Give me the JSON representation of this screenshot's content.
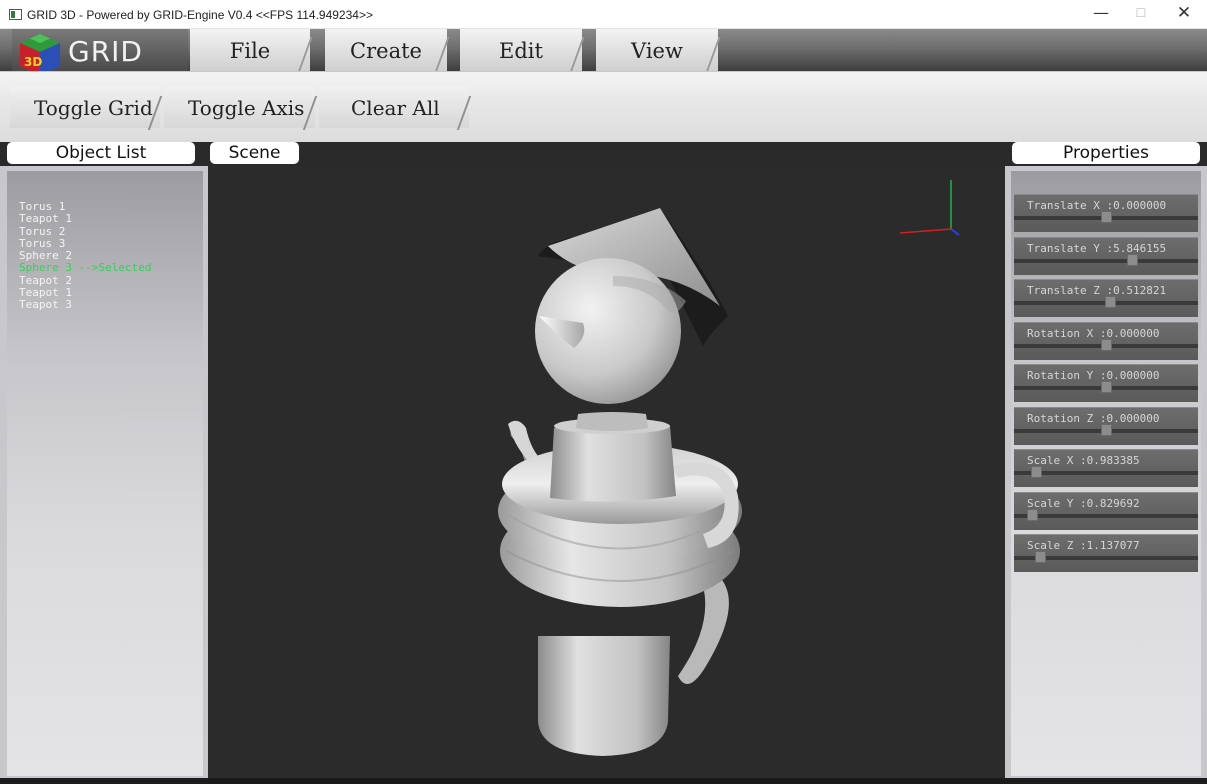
{
  "window": {
    "title": "GRID 3D - Powered by GRID-Engine V0.4 <<FPS 114.949234>>",
    "minimize": "—",
    "maximize": "☐",
    "close": "✕"
  },
  "brand": {
    "logo_text": "GRID",
    "logo_cube_label": "3D"
  },
  "menu": {
    "items": [
      "File",
      "Create",
      "Edit",
      "View"
    ]
  },
  "toolbar": {
    "buttons": [
      "Toggle Grid",
      "Toggle Axis",
      "Clear All"
    ]
  },
  "panels": {
    "object_list_title": "Object List",
    "scene_title": "Scene",
    "properties_title": "Properties"
  },
  "object_list": [
    {
      "name": "Torus 1"
    },
    {
      "name": "Teapot 1"
    },
    {
      "name": "Torus 2"
    },
    {
      "name": "Torus 3"
    },
    {
      "name": "Sphere 2"
    },
    {
      "name": "Sphere 3 -->Selected",
      "selected": true
    },
    {
      "name": "Teapot 2"
    },
    {
      "name": "Teapot 1"
    },
    {
      "name": "Teapot 3"
    }
  ],
  "properties": [
    {
      "label": "Translate X :0.000000",
      "level": 0.5
    },
    {
      "label": "Translate Y :5.846155",
      "level": 0.64
    },
    {
      "label": "Translate Z :0.512821",
      "level": 0.52
    },
    {
      "label": "Rotation X :0.000000",
      "level": 0.5
    },
    {
      "label": "Rotation Y :0.000000",
      "level": 0.5
    },
    {
      "label": "Rotation Z :0.000000",
      "level": 0.5
    },
    {
      "label": "Scale X :0.983385",
      "level": 0.12
    },
    {
      "label": "Scale Y :0.829692",
      "level": 0.1
    },
    {
      "label": "Scale Z :1.137077",
      "level": 0.14
    }
  ],
  "colors": {
    "selected_item": "#32d15a",
    "axis_x": "#d42020",
    "axis_y": "#22b14c",
    "axis_z": "#2244ee",
    "logo_red": "#c8202a",
    "logo_green": "#2e9a3c",
    "logo_blue": "#2b4fb8"
  }
}
